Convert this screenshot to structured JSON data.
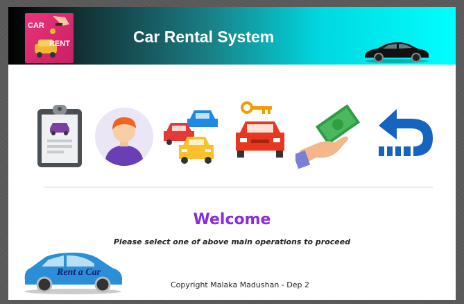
{
  "header": {
    "title": "Car Rental System",
    "logo_text_top": "CAR",
    "logo_text_bottom": "RENT",
    "logo_icon": "car-rent-logo",
    "car_icon": "sports-car-icon"
  },
  "operations": [
    {
      "icon": "clipboard-car-icon"
    },
    {
      "icon": "customer-avatar-icon"
    },
    {
      "icon": "cars-fleet-icon"
    },
    {
      "icon": "car-key-icon"
    },
    {
      "icon": "payment-money-icon"
    },
    {
      "icon": "return-arrow-icon"
    }
  ],
  "main": {
    "welcome": "Welcome",
    "subtitle": "Please select one of above main operations to proceed"
  },
  "footer": {
    "rent_car_text": "Rent a Car",
    "copyright": "Copyright Malaka Madushan  - Dep 2"
  },
  "colors": {
    "accent": "#8a2be2",
    "header_start": "#000000",
    "header_end": "#00ffff",
    "logo_pink": "#e9357a"
  }
}
